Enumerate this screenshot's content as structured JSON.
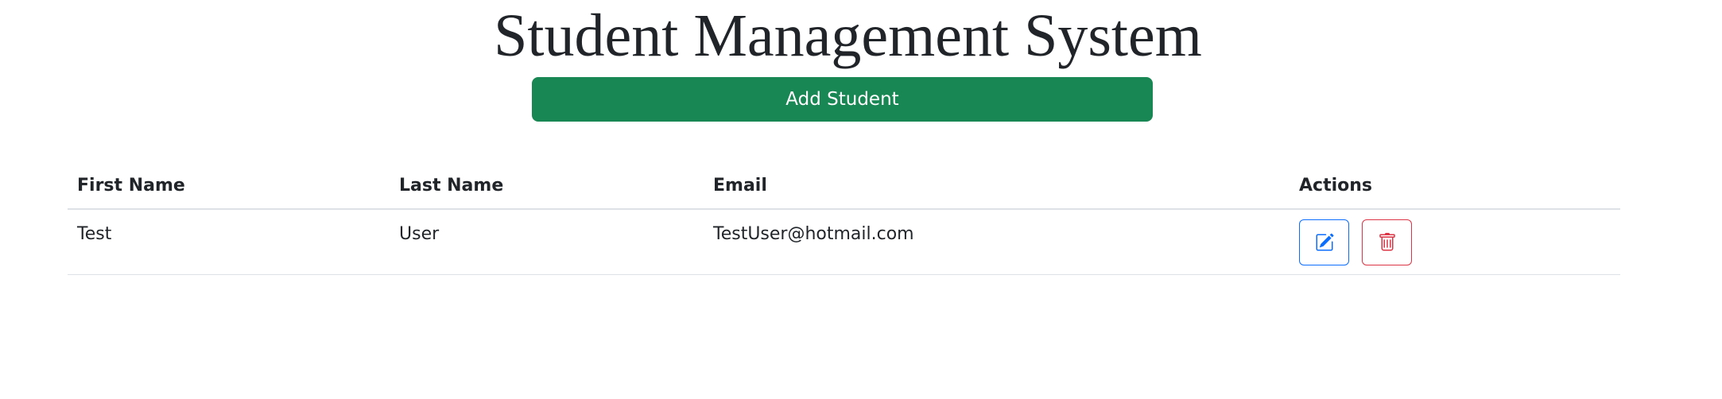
{
  "page": {
    "title": "Student Management System"
  },
  "toolbar": {
    "add_label": "Add Student"
  },
  "table": {
    "headers": [
      "First Name",
      "Last Name",
      "Email",
      "Actions"
    ],
    "rows": [
      {
        "first_name": "Test",
        "last_name": "User",
        "email": "TestUser@hotmail.com",
        "actions": [
          "edit-icon",
          "delete-icon"
        ]
      }
    ]
  },
  "colors": {
    "primary_success": "#198754",
    "edit_accent": "#0d6efd",
    "delete_accent": "#dc3545",
    "text": "#212529",
    "border": "#dee2e6"
  }
}
